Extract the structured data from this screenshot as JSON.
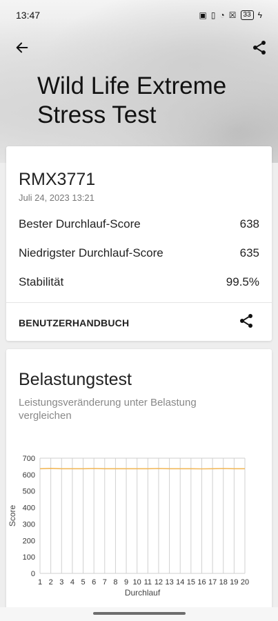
{
  "status_bar": {
    "time": "13:47",
    "battery": "33"
  },
  "header": {
    "title_line1": "Wild Life Extreme",
    "title_line2": "Stress Test"
  },
  "summary": {
    "device": "RMX3771",
    "date": "Juli 24, 2023 13:21",
    "rows": [
      {
        "label": "Bester Durchlauf-Score",
        "value": "638"
      },
      {
        "label": "Niedrigster Durchlauf-Score",
        "value": "635"
      },
      {
        "label": "Stabilität",
        "value": "99.5%"
      }
    ],
    "manual_label": "BENUTZERHANDBUCH"
  },
  "stress": {
    "title": "Belastungstest",
    "subtitle": "Leistungsveränderung unter Belastung vergleichen"
  },
  "colors": {
    "line": "#f2b85a",
    "grid": "#d0d0d0",
    "text": "#222222"
  },
  "chart_data": {
    "type": "line",
    "xlabel": "Durchlauf",
    "ylabel": "Score",
    "ylim": [
      0,
      700
    ],
    "yticks": [
      0,
      100,
      200,
      300,
      400,
      500,
      600,
      700
    ],
    "x": [
      1,
      2,
      3,
      4,
      5,
      6,
      7,
      8,
      9,
      10,
      11,
      12,
      13,
      14,
      15,
      16,
      17,
      18,
      19,
      20
    ],
    "series": [
      {
        "values": [
          636,
          638,
          636,
          636,
          636,
          637,
          636,
          636,
          636,
          636,
          636,
          637,
          636,
          636,
          636,
          635,
          636,
          637,
          636,
          636
        ]
      }
    ],
    "grid": true
  }
}
